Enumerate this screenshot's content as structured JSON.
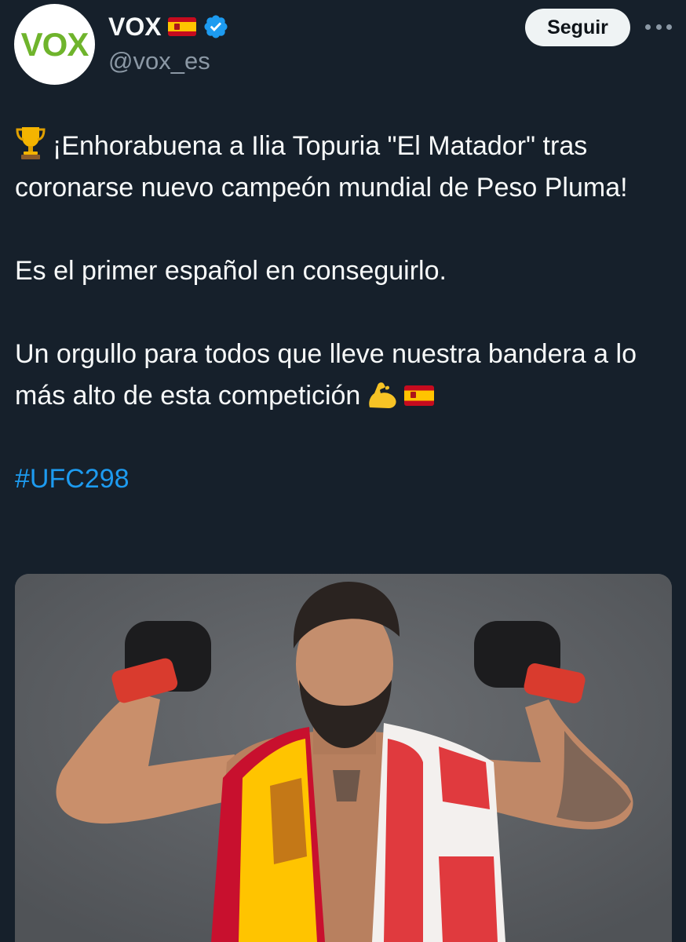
{
  "author": {
    "avatar_text": "VOX",
    "display_name": "VOX",
    "handle": "@vox_es",
    "flag_icon": "spain-flag-icon",
    "verified_icon": "verified-badge-icon"
  },
  "actions": {
    "follow_label": "Seguir",
    "more_icon": "more-options-icon"
  },
  "tweet": {
    "line1": "¡Enhorabuena a Ilia Topuria \"El Matador\" tras coronarse nuevo campeón mundial de Peso Pluma!",
    "line2": "Es el primer español en conseguirlo.",
    "line3": "Un orgullo para todos que lleve nuestra bandera a lo más alto de esta competición",
    "hashtag": "#UFC298",
    "leading_icon": "trophy-icon",
    "trailing_icons": [
      "flexed-biceps-icon",
      "spain-flag-icon"
    ]
  },
  "media": {
    "description_icon": "fighter-photo"
  },
  "colors": {
    "background": "#15202b",
    "text": "#f7f9f9",
    "muted": "#8b98a5",
    "link": "#1d9bf0",
    "verified": "#1d9bf0",
    "vox_green": "#6fb42c"
  }
}
